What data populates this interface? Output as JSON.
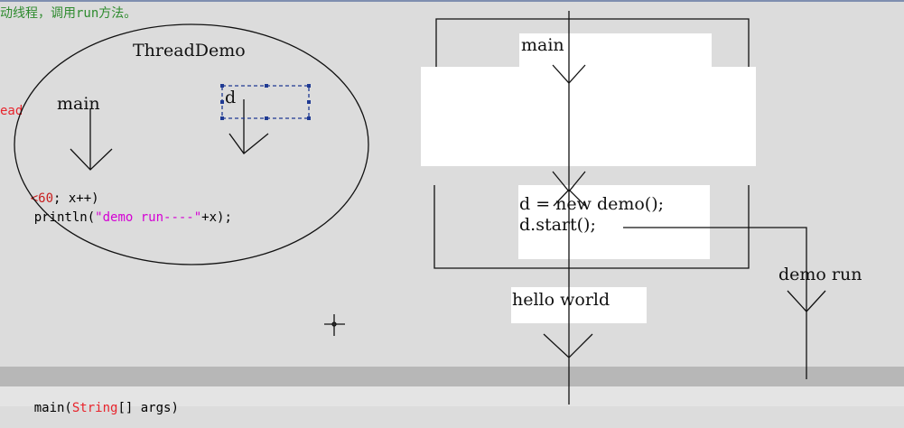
{
  "code": {
    "comment_line": "动线程，调用run方法。",
    "thread_keyword": "ead",
    "for_fragment_num": "<60",
    "for_fragment_rest": "; x++)",
    "println_prefix": "println(",
    "println_string": "\"demo run----\"",
    "println_suffix": "+x);",
    "main_prefix": "main(",
    "main_type": "String",
    "main_suffix": "[] args)"
  },
  "diagram": {
    "ellipse_title": "ThreadDemo",
    "main_label_left": "main",
    "object_label": "d",
    "main_label_right": "main",
    "stmt_new": "d = new demo();",
    "stmt_start": "d.start();",
    "output_hello": "hello world",
    "output_demo_run": "demo run"
  },
  "colors": {
    "background": "#dcdcdc",
    "comment_green": "#2e8b2e",
    "keyword_red": "#e8242c",
    "string_magenta": "#d400d4",
    "number_red": "#c81e1e",
    "line": "#111111",
    "dashed_box": "#1f3a93"
  }
}
